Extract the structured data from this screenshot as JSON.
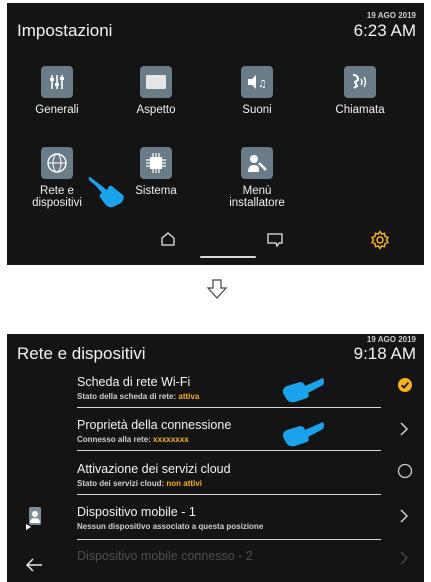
{
  "screen1": {
    "title": "Impostazioni",
    "date": "19 AGO 2019",
    "time": "6:23 AM",
    "tiles": [
      {
        "label": "Generali",
        "icon": "sliders-icon"
      },
      {
        "label": "Aspetto",
        "icon": "display-icon"
      },
      {
        "label": "Suoni",
        "icon": "sound-icon"
      },
      {
        "label": "Chiamata",
        "icon": "call-icon"
      },
      {
        "label": "Rete e dispositivi",
        "icon": "network-icon"
      },
      {
        "label": "Sistema",
        "icon": "chip-icon"
      },
      {
        "label": "Menù installatore",
        "icon": "installer-icon"
      }
    ],
    "dock": [
      "home-icon",
      "message-icon",
      "settings-icon"
    ],
    "accent": "#f7b21b"
  },
  "screen2": {
    "title": "Rete e dispositivi",
    "date": "19 AGO 2019",
    "time": "9:18 AM",
    "rows": [
      {
        "title": "Scheda di rete Wi-Fi",
        "sub_label": "Stato della scheda di rete:",
        "sub_value": "attiva",
        "trailing": "check-icon"
      },
      {
        "title": "Proprietà della connessione",
        "sub_label": "Connesso alla rete:",
        "sub_value": "xxxxxxxx",
        "trailing": "chevron-right-icon"
      },
      {
        "title": "Attivazione dei servizi cloud",
        "sub_label": "Stato dei servizi cloud:",
        "sub_value": "non attivi",
        "trailing": "radio-icon"
      },
      {
        "title": "Dispositivo mobile - 1",
        "sub_label": "Nessun dispositivo associato a questa posizione",
        "sub_value": "",
        "trailing": "chevron-right-icon"
      },
      {
        "title": "Dispositivo mobile connesso - 2",
        "sub_label": "",
        "sub_value": "",
        "trailing": "chevron-right-icon"
      }
    ]
  }
}
